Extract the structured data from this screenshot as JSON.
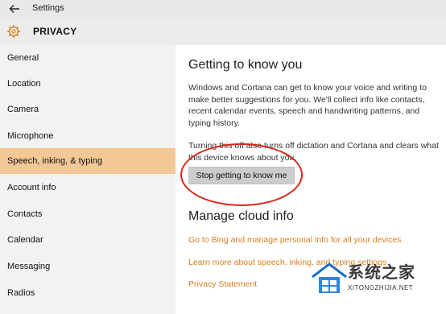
{
  "window": {
    "title": "Settings"
  },
  "header": {
    "title": "PRIVACY"
  },
  "sidebar": {
    "items": [
      {
        "label": "General"
      },
      {
        "label": "Location"
      },
      {
        "label": "Camera"
      },
      {
        "label": "Microphone"
      },
      {
        "label": "Speech, inking, & typing",
        "selected": true
      },
      {
        "label": "Account info"
      },
      {
        "label": "Contacts"
      },
      {
        "label": "Calendar"
      },
      {
        "label": "Messaging"
      },
      {
        "label": "Radios"
      }
    ]
  },
  "main": {
    "section1_title": "Getting to know you",
    "paragraph1": "Windows and Cortana can get to know your voice and writing to make better suggestions for you. We'll collect info like contacts, recent calendar events, speech and handwriting patterns, and typing history.",
    "paragraph2": "Turning this off also turns off dictation and Cortana and clears what this device knows about you.",
    "stop_button": "Stop getting to know me",
    "section2_title": "Manage cloud info",
    "links": [
      "Go to Bing and manage personal info for all your devices",
      "Learn more about speech, inking, and typing settings",
      "Privacy Statement"
    ]
  },
  "watermark": {
    "text_cn": "系统之家",
    "text_en": "XITONGZHIJIA.NET"
  },
  "colors": {
    "accent": "#d98021",
    "selected_bg": "#f2c896",
    "sidebar_bg": "#f2f2f2",
    "annotation_circle": "#d42a1d"
  },
  "icons": {
    "back": "back-arrow-icon",
    "settings": "gear-icon"
  }
}
